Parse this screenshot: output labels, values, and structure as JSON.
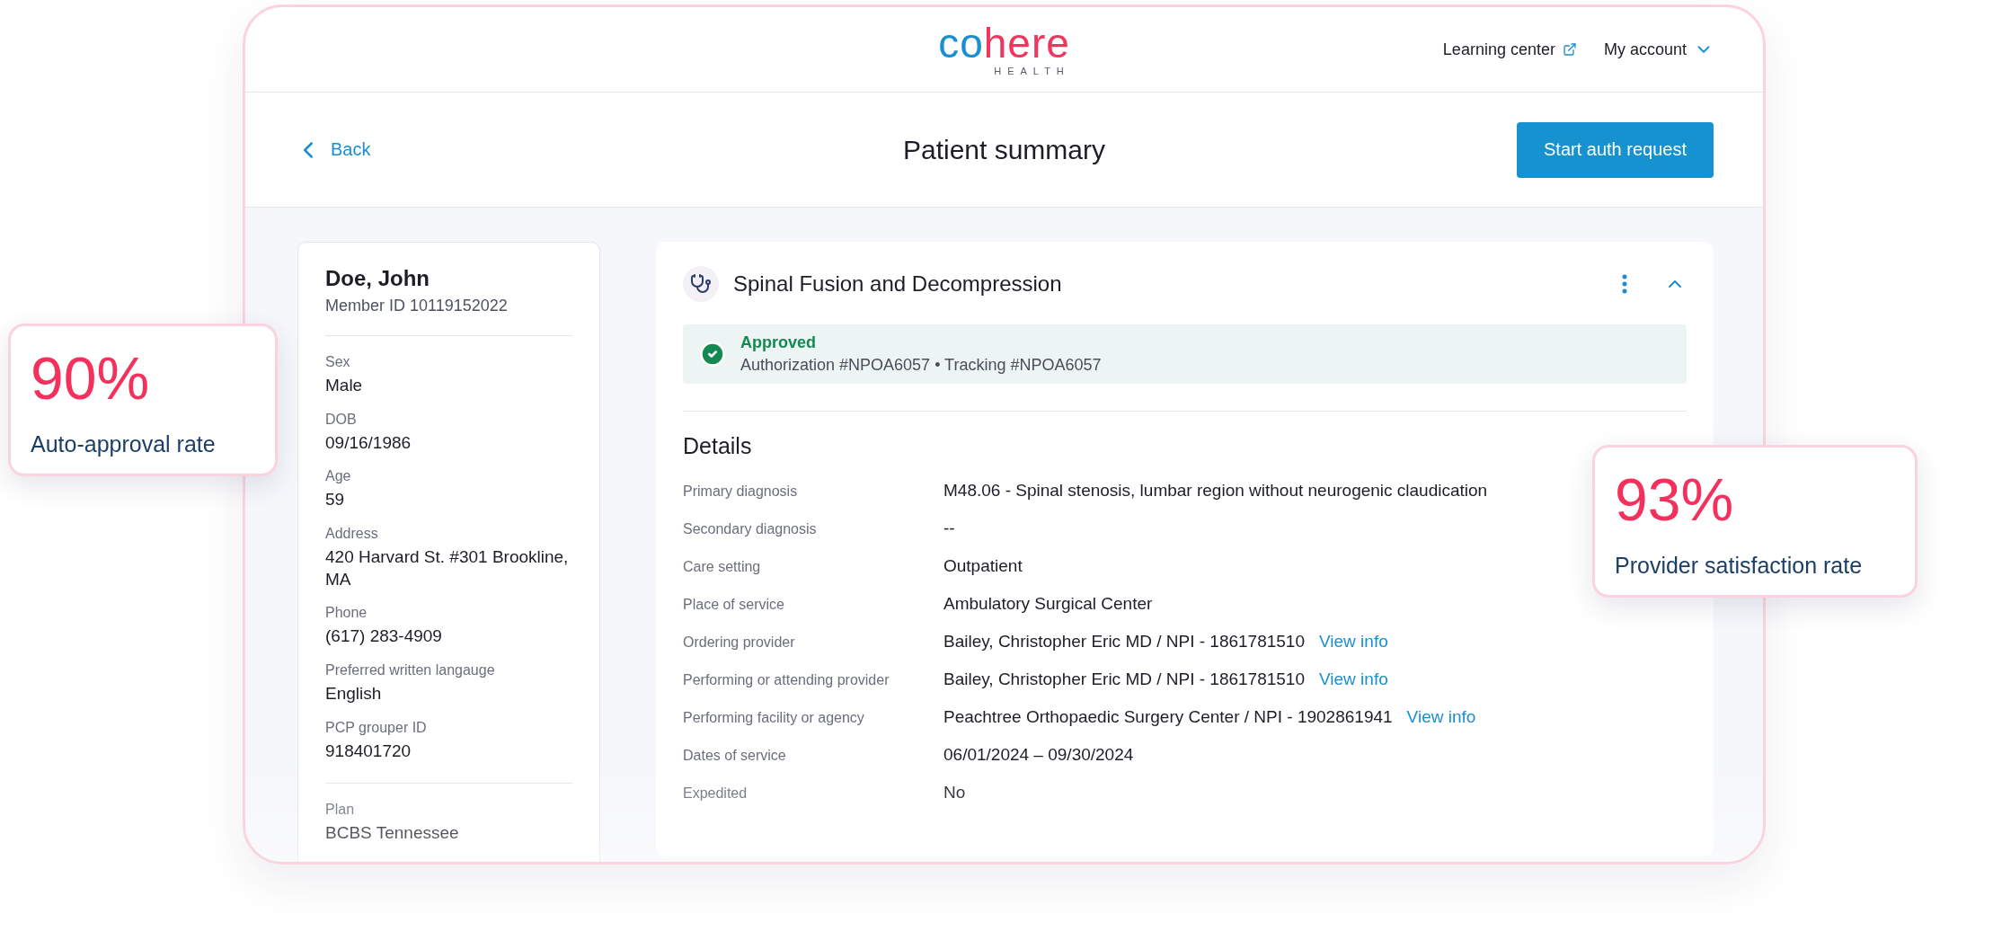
{
  "header": {
    "logo": [
      {
        "text": "co",
        "color": "#1a8fd0"
      },
      {
        "text": "here",
        "color": "#f0365f"
      }
    ],
    "logo_sub": "HEALTH",
    "links": [
      {
        "label": "Learning center",
        "kind": "external"
      },
      {
        "label": "My account",
        "kind": "menu"
      }
    ]
  },
  "subheader": {
    "back": "Back",
    "title": "Patient summary",
    "action": "Start auth request"
  },
  "patient": {
    "name": "Doe, John",
    "member_id": "Member ID 10119152022",
    "fields": [
      {
        "label": "Sex",
        "value": "Male"
      },
      {
        "label": "DOB",
        "value": "09/16/1986"
      },
      {
        "label": "Age",
        "value": "59"
      },
      {
        "label": "Address",
        "value": "420 Harvard St. #301 Brookline, MA"
      },
      {
        "label": "Phone",
        "value": "(617) 283-4909"
      },
      {
        "label": "Preferred written langauge",
        "value": "English"
      },
      {
        "label": "PCP grouper ID",
        "value": "918401720"
      }
    ],
    "plan_fields": [
      {
        "label": "Plan",
        "value": "BCBS Tennessee"
      }
    ]
  },
  "request": {
    "title": "Spinal Fusion and Decompression",
    "expanded": true,
    "status": {
      "kind": "approved",
      "label": "Approved",
      "detail": "Authorization #NPOA6057 • Tracking #NPOA6057"
    },
    "details_title": "Details",
    "rows": [
      {
        "label": "Primary diagnosis",
        "value": "M48.06 - Spinal stenosis, lumbar region without neurogenic claudication"
      },
      {
        "label": "Secondary diagnosis",
        "value": "--"
      },
      {
        "label": "Care setting",
        "value": "Outpatient"
      },
      {
        "label": "Place of service",
        "value": "Ambulatory Surgical Center"
      },
      {
        "label": "Ordering provider",
        "value": "Bailey, Christopher Eric MD / NPI - 1861781510",
        "link": "View info"
      },
      {
        "label": "Performing or attending provider",
        "value": "Bailey, Christopher Eric MD / NPI - 1861781510",
        "link": "View info"
      },
      {
        "label": "Performing facility or agency",
        "value": "Peachtree Orthopaedic Surgery Center / NPI - 1902861941",
        "link": "View info"
      },
      {
        "label": "Dates of service",
        "value": "06/01/2024 – 09/30/2024"
      },
      {
        "label": "Expedited",
        "value": "No"
      }
    ]
  },
  "stats": [
    {
      "value": "90%",
      "label": "Auto-approval rate"
    },
    {
      "value": "93%",
      "label": "Provider satisfaction rate"
    }
  ]
}
